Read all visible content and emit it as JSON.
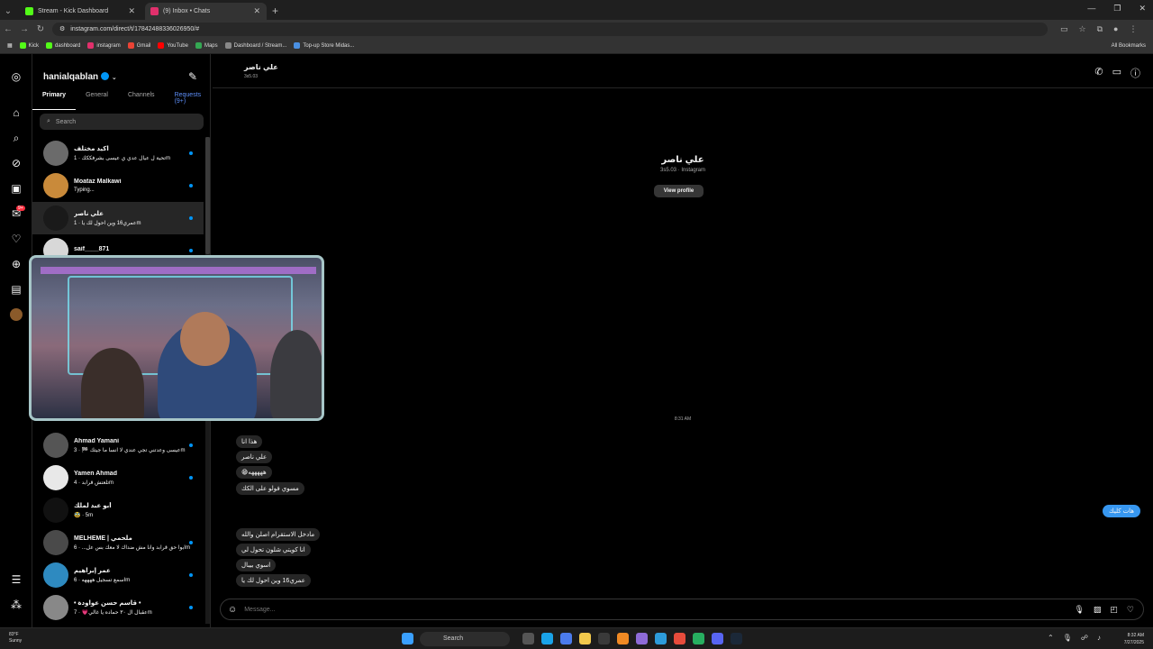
{
  "browser": {
    "tabs": [
      {
        "title": "Stream - Kick Dashboard",
        "color": "#53fc18",
        "active": false
      },
      {
        "title": "(9) Inbox • Chats",
        "color": "#e1306c",
        "active": true
      }
    ],
    "url": "instagram.com/direct/t/17842488336026950/#",
    "bookmarks": [
      {
        "label": "Kick",
        "color": "#53fc18"
      },
      {
        "label": "dashboard",
        "color": "#53fc18"
      },
      {
        "label": "instagram",
        "color": "#e1306c"
      },
      {
        "label": "Gmail",
        "color": "#ea4335"
      },
      {
        "label": "YouTube",
        "color": "#ff0000"
      },
      {
        "label": "Maps",
        "color": "#34a853"
      },
      {
        "label": "Dashboard / Stream...",
        "color": "#888888"
      },
      {
        "label": "Top-up Store Midas...",
        "color": "#4a90e2"
      }
    ],
    "all_bookmarks": "All Bookmarks"
  },
  "sidebar": {
    "username": "hanialqablan",
    "tabs": {
      "primary": "Primary",
      "general": "General",
      "channels": "Channels",
      "requests": "Requests (9+)"
    },
    "search_placeholder": "Search",
    "notif_badge": "9+",
    "conversations": [
      {
        "name": "اكيد مختلف",
        "preview": "تحية ل عيال عدي ي عيسى بشرفككك · 1m",
        "color": "#6b6b6b",
        "unread": true
      },
      {
        "name": "Moataz Malkawi",
        "preview": "Typing...",
        "color": "#c98a3a",
        "unread": true
      },
      {
        "name": "علي ناصر",
        "preview": "عمري16 وين احول لك يا · 1m",
        "color": "#1a1a1a",
        "unread": true
      },
      {
        "name": "saif____871",
        "preview": "",
        "color": "#d8d8d8",
        "unread": true
      },
      {
        "name": "Ahmad Yamani",
        "preview": "عيسى وعدتني تجي عندي لا انسا ما جيتك 🏁 · 3m",
        "color": "#555555",
        "unread": true
      },
      {
        "name": "Yamen Ahmad",
        "preview": "تلعتش قرابد · 4m",
        "color": "#e8e8e8",
        "unread": true
      },
      {
        "name": "أبو عبد لملك",
        "preview": "🥸 · 5m",
        "color": "#111111",
        "unread": false
      },
      {
        "name": "MELHEME | ملحمي",
        "preview": "ابوا حق قرابد وانا مش ضداك لا معك بس عل... · 6m",
        "color": "#4a4a4a",
        "unread": true
      },
      {
        "name": "عمر إبراهيم",
        "preview": "اسمع تسجيل ههههه · 6m",
        "color": "#2e8ac0",
        "unread": true
      },
      {
        "name": "• قاسم حسن عواودة •",
        "preview": "عقبال ال ٣٠ حماده يا غالي💗 · 7m",
        "color": "#888888",
        "unread": true
      }
    ]
  },
  "chat": {
    "name": "علي ناصر",
    "handle": "3s5.03",
    "profile_sub": "3s5.03 · Instagram",
    "view_profile": "View profile",
    "timestamp": "8:31 AM",
    "received": [
      "هذا انا",
      "علي ناصر",
      "😁هههههه",
      "مسوي فولو على الكك",
      "مادخل الاستقرام اصلن والله",
      "انا كويتي شلون تحول لي",
      "اسوي بيبال",
      "عمري16 وين احول لك يا"
    ],
    "sent": "هات كليك",
    "composer_placeholder": "Message..."
  },
  "taskbar": {
    "weather_temp": "83°F",
    "weather_desc": "Sunny",
    "search": "Search",
    "time": "8:32 AM",
    "date": "7/27/2025"
  }
}
